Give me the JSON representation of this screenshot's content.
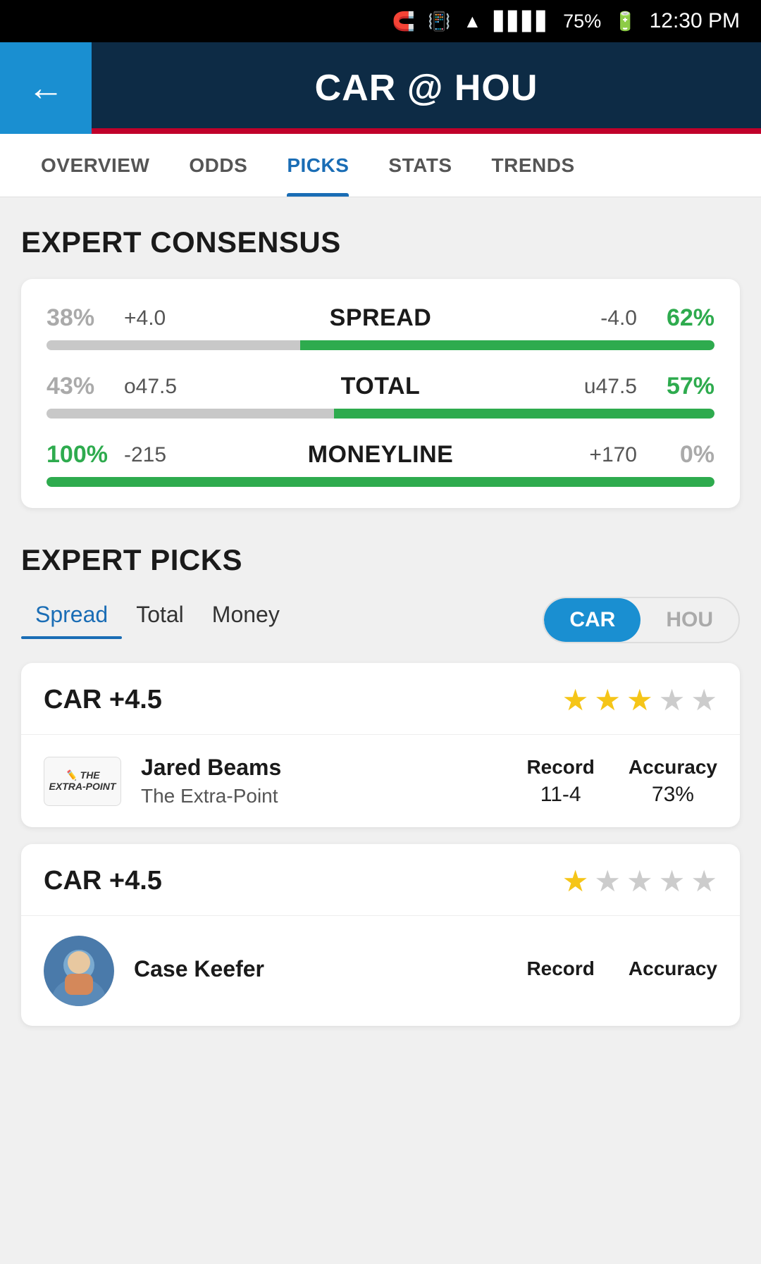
{
  "statusBar": {
    "bluetooth": "⚡",
    "vibrate": "📳",
    "wifi": "▲",
    "signal": "▋▋▋▋",
    "batteryPct": "75%",
    "battery": "🔋",
    "time": "12:30 PM"
  },
  "header": {
    "backLabel": "←",
    "title": "CAR @ HOU"
  },
  "navTabs": {
    "tabs": [
      {
        "label": "OVERVIEW",
        "active": false
      },
      {
        "label": "ODDS",
        "active": false
      },
      {
        "label": "PICKS",
        "active": true
      },
      {
        "label": "STATS",
        "active": false
      },
      {
        "label": "TRENDS",
        "active": false
      }
    ]
  },
  "expertConsensus": {
    "sectionTitle": "EXPERT CONSENSUS",
    "rows": [
      {
        "pctLeft": "38%",
        "pctLeftGreen": false,
        "valueLeft": "+4.0",
        "label": "SPREAD",
        "valueRight": "-4.0",
        "pctRight": "62%",
        "pctRightGreen": true,
        "leftWidth": 38,
        "rightWidth": 62
      },
      {
        "pctLeft": "43%",
        "pctLeftGreen": false,
        "valueLeft": "o47.5",
        "label": "TOTAL",
        "valueRight": "u47.5",
        "pctRight": "57%",
        "pctRightGreen": true,
        "leftWidth": 43,
        "rightWidth": 57
      },
      {
        "pctLeft": "100%",
        "pctLeftGreen": true,
        "valueLeft": "-215",
        "label": "MONEYLINE",
        "valueRight": "+170",
        "pctRight": "0%",
        "pctRightGreen": false,
        "leftWidth": 100,
        "rightWidth": 0
      }
    ]
  },
  "expertPicks": {
    "sectionTitle": "EXPERT PICKS",
    "filterTabs": [
      {
        "label": "Spread",
        "active": true
      },
      {
        "label": "Total",
        "active": false
      },
      {
        "label": "Money",
        "active": false
      }
    ],
    "teamToggle": [
      {
        "label": "CAR",
        "active": true
      },
      {
        "label": "HOU",
        "active": false
      }
    ],
    "picks": [
      {
        "title": "CAR +4.5",
        "stars": [
          true,
          true,
          true,
          false,
          false
        ],
        "expertLogoText": "THE EXTRA-POINT",
        "expertName": "Jared Beams",
        "expertOutlet": "The Extra-Point",
        "recordLabel": "Record",
        "recordValue": "11-4",
        "accuracyLabel": "Accuracy",
        "accuracyValue": "73%"
      },
      {
        "title": "CAR +4.5",
        "stars": [
          true,
          false,
          false,
          false,
          false
        ],
        "expertName": "Case Keefer",
        "expertOutlet": "",
        "recordLabel": "Record",
        "recordValue": "",
        "accuracyLabel": "Accuracy",
        "accuracyValue": ""
      }
    ]
  }
}
